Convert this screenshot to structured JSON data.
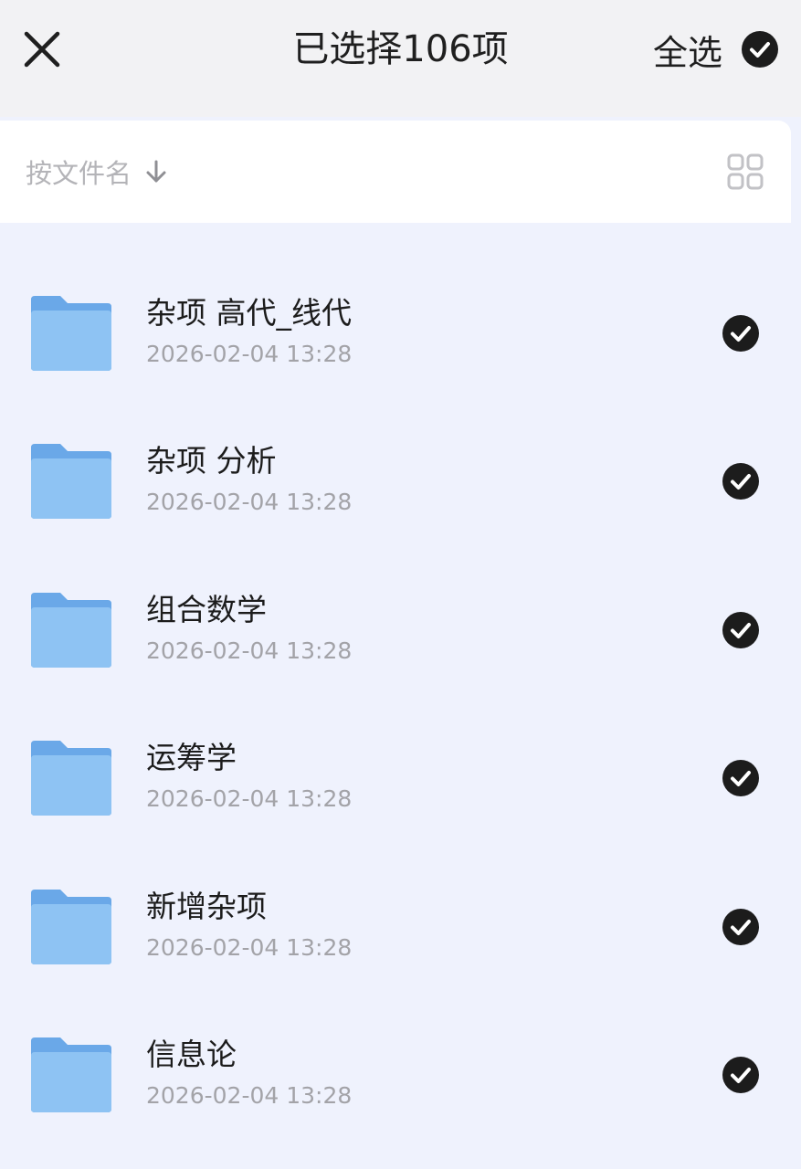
{
  "header": {
    "title": "已选择106项",
    "select_all_label": "全选",
    "close_icon": "close-icon",
    "select_all_icon": "check-circle-icon"
  },
  "sortbar": {
    "sort_label": "按文件名",
    "sort_icon": "arrow-down-icon",
    "view_icon": "grid-view-icon"
  },
  "files": [
    {
      "name": "杂项 高代_线代",
      "date": "2026-02-04 13:28",
      "selected": true
    },
    {
      "name": "杂项 分析",
      "date": "2026-02-04 13:28",
      "selected": true
    },
    {
      "name": "组合数学",
      "date": "2026-02-04 13:28",
      "selected": true
    },
    {
      "name": "运筹学",
      "date": "2026-02-04 13:28",
      "selected": true
    },
    {
      "name": "新增杂项",
      "date": "2026-02-04 13:28",
      "selected": true
    },
    {
      "name": "信息论",
      "date": "2026-02-04 13:28",
      "selected": true
    }
  ],
  "colors": {
    "background": "#eff2fd",
    "folder": "#7fb8f0",
    "check": "#1c1c1c"
  }
}
